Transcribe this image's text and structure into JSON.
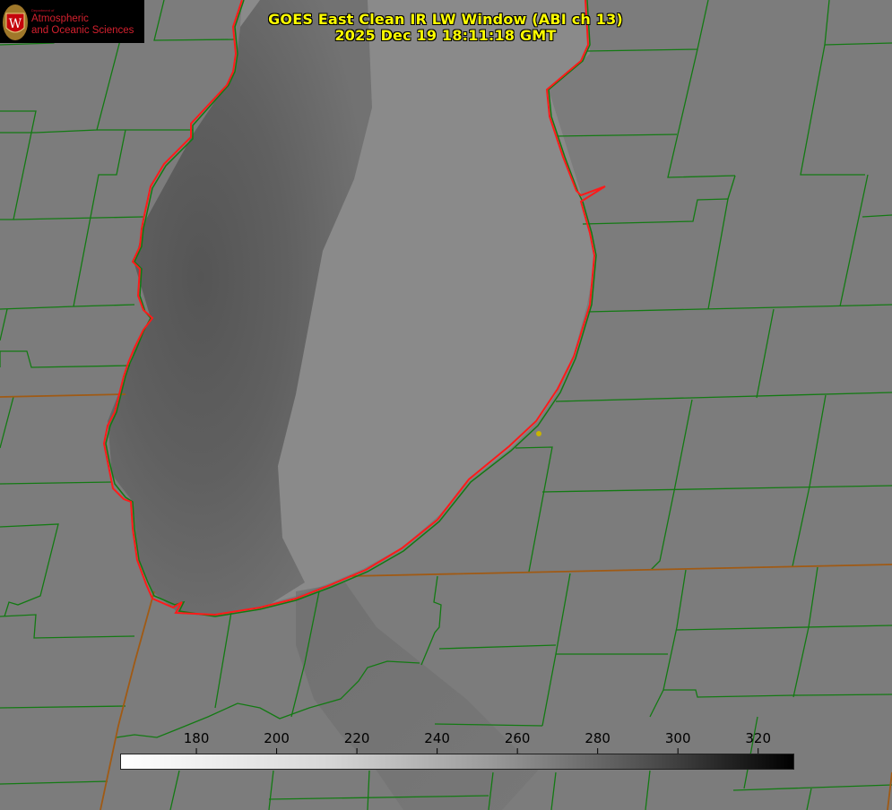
{
  "title_line1": "GOES East Clean IR LW Window (ABI ch 13)",
  "title_line2": "2025 Dec 19 18:11:18 GMT",
  "logo": {
    "dept": "Department of",
    "line1": "Atmospheric",
    "line2": "and Oceanic Sciences",
    "seal_letter": "W"
  },
  "colorbar": {
    "unit_values": [
      180,
      200,
      220,
      240,
      260,
      280,
      300,
      320
    ],
    "labels": [
      "180",
      "200",
      "220",
      "240",
      "260",
      "280",
      "300",
      "320"
    ]
  },
  "colors": {
    "background_gray": "#7c7c7c",
    "lake_dark": "#5a5a5a",
    "county_lines": "#137a13",
    "state_lines": "#a05a14",
    "coastline": "#ff1a1a",
    "title": "#ffff00",
    "marker": "#c8b400"
  },
  "marker_name": "yellow-dot"
}
